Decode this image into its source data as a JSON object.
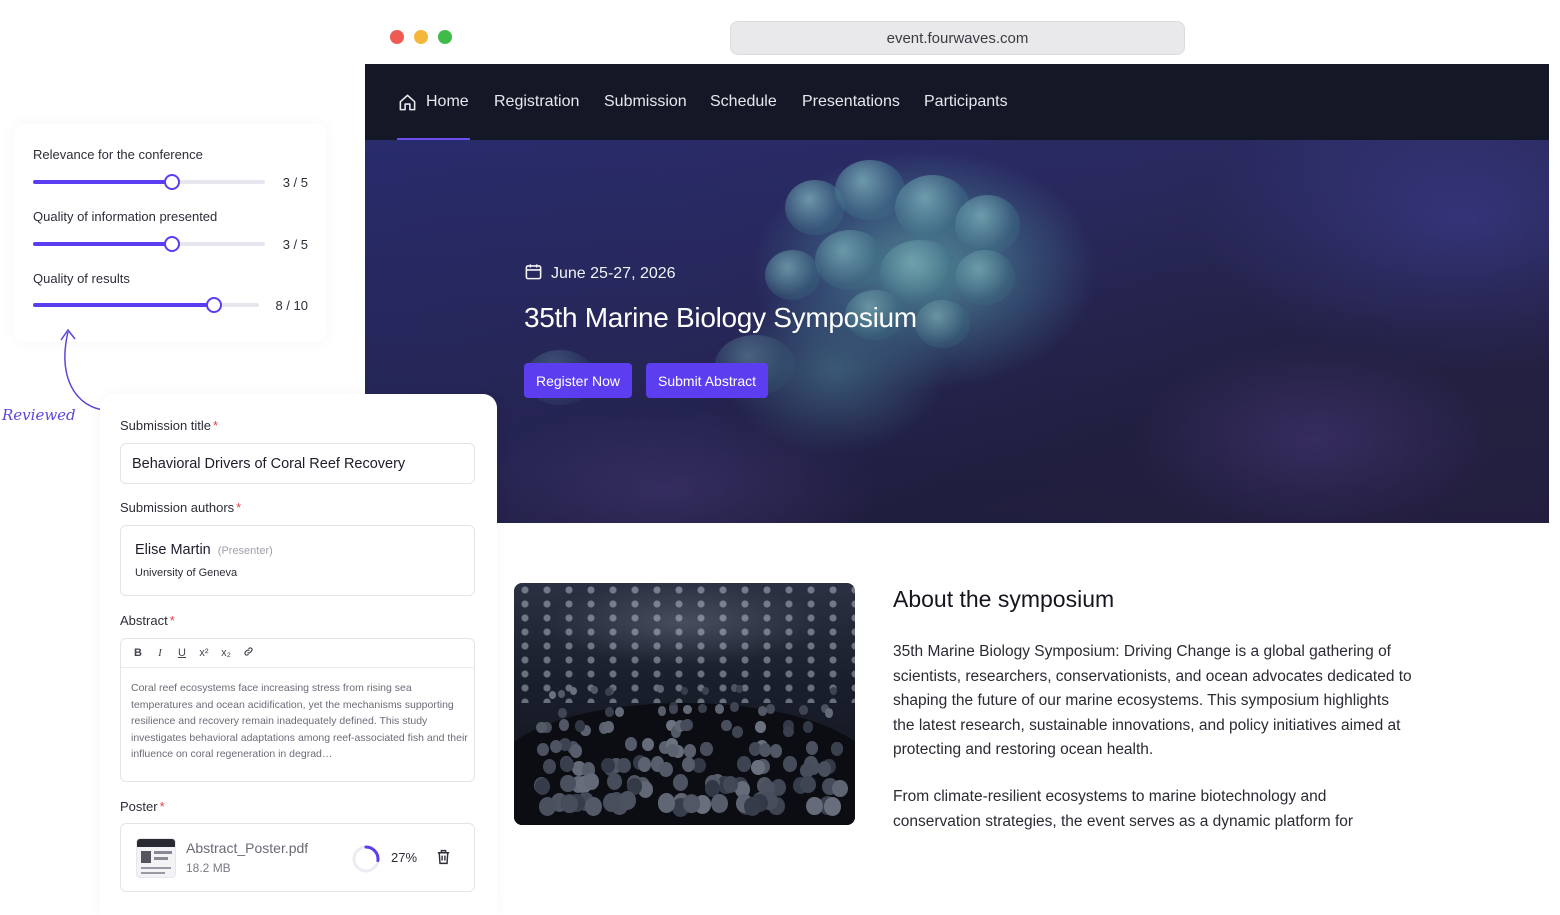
{
  "browser": {
    "url": "event.fourwaves.com",
    "window_dots": [
      "#ee5b52",
      "#f4b73c",
      "#3fbb4a"
    ]
  },
  "nav": {
    "items": [
      {
        "label": "Home",
        "icon": "home-icon",
        "active": true
      },
      {
        "label": "Registration"
      },
      {
        "label": "Submission"
      },
      {
        "label": "Schedule"
      },
      {
        "label": "Presentations"
      },
      {
        "label": "Participants"
      }
    ],
    "accent": "#6c4df0"
  },
  "hero": {
    "date": "June 25-27, 2026",
    "date_icon": "calendar-icon",
    "title": "35th Marine Biology Symposium",
    "register_label": "Register Now",
    "submit_label": "Submit Abstract",
    "button_color": "#5c3ef0"
  },
  "about": {
    "title": "About the symposium",
    "paragraph1": "35th Marine Biology Symposium: Driving Change is a global gathering of scientists, researchers, conservationists, and ocean advocates dedicated to shaping the future of our marine ecosystems. This symposium highlights the latest research, sustainable innovations, and policy initiatives aimed at protecting and restoring ocean health.",
    "paragraph2": "From climate-resilient ecosystems to marine biotechnology and conservation strategies, the event serves as a dynamic platform for"
  },
  "review": {
    "criteria": [
      {
        "label": "Relevance for the conference",
        "score_text": "3 / 5",
        "level": 0.6
      },
      {
        "label": "Quality of information presented",
        "score_text": "3 / 5",
        "level": 0.6
      },
      {
        "label": "Quality of results",
        "score_text": "8 / 10",
        "level": 0.8
      }
    ],
    "annotation": "Reviewed"
  },
  "submission": {
    "title_label": "Submission title",
    "title_value": "Behavioral Drivers of Coral Reef Recovery",
    "authors_label": "Submission authors",
    "author_name": "Elise Martin",
    "author_role": "(Presenter)",
    "author_institution": "University of Geneva",
    "abstract_label": "Abstract",
    "toolbar": [
      "B",
      "I",
      "U",
      "x²",
      "x₂",
      "link-icon"
    ],
    "abstract_text": "Coral reef ecosystems face increasing stress from rising sea temperatures and ocean acidification, yet the mechanisms supporting resilience and recovery remain inadequately defined. This study investigates behavioral adaptations among reef-associated fish and their influence on coral regeneration in degrad…",
    "poster_label": "Poster",
    "file_name": "Abstract_Poster.pdf",
    "file_size": "18.2 MB",
    "upload_progress": 27,
    "upload_progress_text": "27%",
    "required_mark": "*"
  }
}
